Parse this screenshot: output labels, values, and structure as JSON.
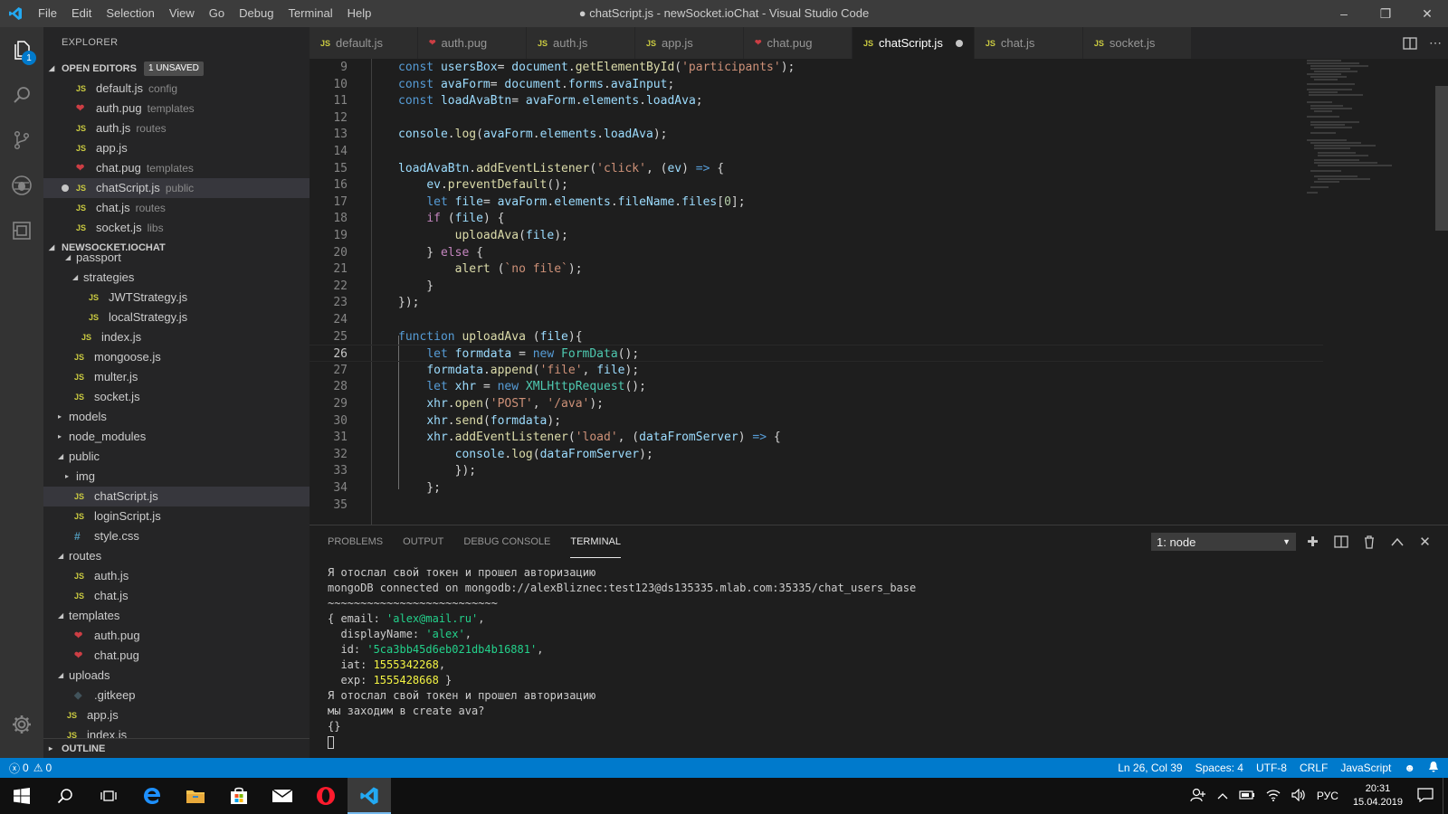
{
  "titlebar": {
    "menus": [
      "File",
      "Edit",
      "Selection",
      "View",
      "Go",
      "Debug",
      "Terminal",
      "Help"
    ],
    "title": "● chatScript.js - newSocket.ioChat - Visual Studio Code",
    "minimize": "–",
    "maximize": "❐",
    "close": "✕"
  },
  "activitybar": {
    "items": [
      "files-icon",
      "search-icon",
      "source-control-icon",
      "debug-icon",
      "extensions-icon"
    ],
    "explorer_badge": "1"
  },
  "sidebar": {
    "title": "EXPLORER",
    "open_editors": {
      "header": "OPEN EDITORS",
      "badge": "1 UNSAVED",
      "items": [
        {
          "icon": "JS",
          "name": "default.js",
          "desc": "config"
        },
        {
          "icon": "pug",
          "name": "auth.pug",
          "desc": "templates"
        },
        {
          "icon": "JS",
          "name": "auth.js",
          "desc": "routes"
        },
        {
          "icon": "JS",
          "name": "app.js",
          "desc": ""
        },
        {
          "icon": "pug",
          "name": "chat.pug",
          "desc": "templates"
        },
        {
          "icon": "JS",
          "name": "chatScript.js",
          "desc": "public"
        },
        {
          "icon": "JS",
          "name": "chat.js",
          "desc": "routes"
        },
        {
          "icon": "JS",
          "name": "socket.js",
          "desc": "libs"
        }
      ]
    },
    "project": {
      "header": "NEWSOCKET.IOCHAT",
      "items": [
        {
          "name": "passport",
          "type": "folder-open",
          "indent": 2
        },
        {
          "name": "strategies",
          "type": "folder-open",
          "indent": 3
        },
        {
          "name": "JWTStrategy.js",
          "type": "js",
          "indent": 4
        },
        {
          "name": "localStrategy.js",
          "type": "js",
          "indent": 4
        },
        {
          "name": "index.js",
          "type": "js",
          "indent": 3
        },
        {
          "name": "mongoose.js",
          "type": "js",
          "indent": 2
        },
        {
          "name": "multer.js",
          "type": "js",
          "indent": 2
        },
        {
          "name": "socket.js",
          "type": "js",
          "indent": 2
        },
        {
          "name": "models",
          "type": "folder",
          "indent": 1
        },
        {
          "name": "node_modules",
          "type": "folder",
          "indent": 1
        },
        {
          "name": "public",
          "type": "folder-open",
          "indent": 1
        },
        {
          "name": "img",
          "type": "folder",
          "indent": 2
        },
        {
          "name": "chatScript.js",
          "type": "js",
          "indent": 2
        },
        {
          "name": "loginScript.js",
          "type": "js",
          "indent": 2
        },
        {
          "name": "style.css",
          "type": "css",
          "indent": 2
        },
        {
          "name": "routes",
          "type": "folder-open",
          "indent": 1
        },
        {
          "name": "auth.js",
          "type": "js",
          "indent": 2
        },
        {
          "name": "chat.js",
          "type": "js",
          "indent": 2
        },
        {
          "name": "templates",
          "type": "folder-open",
          "indent": 1
        },
        {
          "name": "auth.pug",
          "type": "pug",
          "indent": 2
        },
        {
          "name": "chat.pug",
          "type": "pug",
          "indent": 2
        },
        {
          "name": "uploads",
          "type": "folder-open",
          "indent": 1
        },
        {
          "name": ".gitkeep",
          "type": "git",
          "indent": 2
        },
        {
          "name": "app.js",
          "type": "js",
          "indent": 1
        },
        {
          "name": "index.js",
          "type": "js",
          "indent": 1
        }
      ]
    },
    "outline_header": "OUTLINE"
  },
  "tabs": [
    {
      "icon": "JS",
      "label": "default.js"
    },
    {
      "icon": "pug",
      "label": "auth.pug"
    },
    {
      "icon": "JS",
      "label": "auth.js"
    },
    {
      "icon": "JS",
      "label": "app.js"
    },
    {
      "icon": "pug",
      "label": "chat.pug"
    },
    {
      "icon": "JS",
      "label": "chatScript.js"
    },
    {
      "icon": "JS",
      "label": "chat.js"
    },
    {
      "icon": "JS",
      "label": "socket.js"
    }
  ],
  "editor": {
    "lines": [
      {
        "n": "9",
        "tokens": [
          [
            "kw",
            "const "
          ],
          [
            "vr",
            "usersBox"
          ],
          [
            "",
            "= "
          ],
          [
            "vr",
            "document"
          ],
          [
            "",
            "."
          ],
          [
            "fn",
            "getElementById"
          ],
          [
            "",
            "("
          ],
          [
            "st",
            "'participants'"
          ],
          [
            "",
            ");"
          ]
        ]
      },
      {
        "n": "10",
        "tokens": [
          [
            "kw",
            "const "
          ],
          [
            "vr",
            "avaForm"
          ],
          [
            "",
            "= "
          ],
          [
            "vr",
            "document"
          ],
          [
            "",
            "."
          ],
          [
            "vr",
            "forms"
          ],
          [
            "",
            "."
          ],
          [
            "vr",
            "avaInput"
          ],
          [
            "",
            ";"
          ]
        ]
      },
      {
        "n": "11",
        "tokens": [
          [
            "kw",
            "const "
          ],
          [
            "vr",
            "loadAvaBtn"
          ],
          [
            "",
            "= "
          ],
          [
            "vr",
            "avaForm"
          ],
          [
            "",
            "."
          ],
          [
            "vr",
            "elements"
          ],
          [
            "",
            "."
          ],
          [
            "vr",
            "loadAva"
          ],
          [
            "",
            ";"
          ]
        ]
      },
      {
        "n": "12",
        "tokens": []
      },
      {
        "n": "13",
        "tokens": [
          [
            "vr",
            "console"
          ],
          [
            "",
            "."
          ],
          [
            "fn",
            "log"
          ],
          [
            "",
            "("
          ],
          [
            "vr",
            "avaForm"
          ],
          [
            "",
            "."
          ],
          [
            "vr",
            "elements"
          ],
          [
            "",
            "."
          ],
          [
            "vr",
            "loadAva"
          ],
          [
            "",
            ");"
          ]
        ]
      },
      {
        "n": "14",
        "tokens": []
      },
      {
        "n": "15",
        "tokens": [
          [
            "vr",
            "loadAvaBtn"
          ],
          [
            "",
            "."
          ],
          [
            "fn",
            "addEventListener"
          ],
          [
            "",
            "("
          ],
          [
            "st",
            "'click'"
          ],
          [
            "",
            ", ("
          ],
          [
            "vr",
            "ev"
          ],
          [
            "",
            ") "
          ],
          [
            "kw",
            "=>"
          ],
          [
            "",
            " {"
          ]
        ]
      },
      {
        "n": "16",
        "tokens": [
          [
            "",
            "    "
          ],
          [
            "vr",
            "ev"
          ],
          [
            "",
            "."
          ],
          [
            "fn",
            "preventDefault"
          ],
          [
            "",
            "();"
          ]
        ]
      },
      {
        "n": "17",
        "tokens": [
          [
            "",
            "    "
          ],
          [
            "kw",
            "let "
          ],
          [
            "vr",
            "file"
          ],
          [
            "",
            "= "
          ],
          [
            "vr",
            "avaForm"
          ],
          [
            "",
            "."
          ],
          [
            "vr",
            "elements"
          ],
          [
            "",
            "."
          ],
          [
            "vr",
            "fileName"
          ],
          [
            "",
            "."
          ],
          [
            "vr",
            "files"
          ],
          [
            "",
            "["
          ],
          [
            "nm",
            "0"
          ],
          [
            "",
            "];"
          ]
        ]
      },
      {
        "n": "18",
        "tokens": [
          [
            "",
            "    "
          ],
          [
            "ct",
            "if "
          ],
          [
            "",
            "("
          ],
          [
            "vr",
            "file"
          ],
          [
            "",
            ") {"
          ]
        ]
      },
      {
        "n": "19",
        "tokens": [
          [
            "",
            "        "
          ],
          [
            "fn",
            "uploadAva"
          ],
          [
            "",
            "("
          ],
          [
            "vr",
            "file"
          ],
          [
            "",
            ");"
          ]
        ]
      },
      {
        "n": "20",
        "tokens": [
          [
            "",
            "    } "
          ],
          [
            "ct",
            "else "
          ],
          [
            "",
            "{"
          ]
        ]
      },
      {
        "n": "21",
        "tokens": [
          [
            "",
            "        "
          ],
          [
            "fn",
            "alert "
          ],
          [
            "",
            "("
          ],
          [
            "st",
            "`no file`"
          ],
          [
            "",
            ");"
          ]
        ]
      },
      {
        "n": "22",
        "tokens": [
          [
            "",
            "    }"
          ]
        ]
      },
      {
        "n": "23",
        "tokens": [
          [
            "",
            "});"
          ]
        ]
      },
      {
        "n": "24",
        "tokens": []
      },
      {
        "n": "25",
        "tokens": [
          [
            "kw",
            "function "
          ],
          [
            "fn",
            "uploadAva "
          ],
          [
            "",
            "("
          ],
          [
            "vr",
            "file"
          ],
          [
            "",
            "){"
          ]
        ]
      },
      {
        "n": "26",
        "tokens": [
          [
            "",
            "    "
          ],
          [
            "kw",
            "let "
          ],
          [
            "vr",
            "formdata "
          ],
          [
            "",
            "= "
          ],
          [
            "kw",
            "new "
          ],
          [
            "cl",
            "FormData"
          ],
          [
            "",
            "();"
          ]
        ]
      },
      {
        "n": "27",
        "tokens": [
          [
            "",
            "    "
          ],
          [
            "vr",
            "formdata"
          ],
          [
            "",
            "."
          ],
          [
            "fn",
            "append"
          ],
          [
            "",
            "("
          ],
          [
            "st",
            "'file'"
          ],
          [
            "",
            ", "
          ],
          [
            "vr",
            "file"
          ],
          [
            "",
            ");"
          ]
        ]
      },
      {
        "n": "28",
        "tokens": [
          [
            "",
            "    "
          ],
          [
            "kw",
            "let "
          ],
          [
            "vr",
            "xhr "
          ],
          [
            "",
            "= "
          ],
          [
            "kw",
            "new "
          ],
          [
            "cl",
            "XMLHttpRequest"
          ],
          [
            "",
            "();"
          ]
        ]
      },
      {
        "n": "29",
        "tokens": [
          [
            "",
            "    "
          ],
          [
            "vr",
            "xhr"
          ],
          [
            "",
            "."
          ],
          [
            "fn",
            "open"
          ],
          [
            "",
            "("
          ],
          [
            "st",
            "'POST'"
          ],
          [
            "",
            ", "
          ],
          [
            "st",
            "'/ava'"
          ],
          [
            "",
            ");"
          ]
        ]
      },
      {
        "n": "30",
        "tokens": [
          [
            "",
            "    "
          ],
          [
            "vr",
            "xhr"
          ],
          [
            "",
            "."
          ],
          [
            "fn",
            "send"
          ],
          [
            "",
            "("
          ],
          [
            "vr",
            "formdata"
          ],
          [
            "",
            ");"
          ]
        ]
      },
      {
        "n": "31",
        "tokens": [
          [
            "",
            "    "
          ],
          [
            "vr",
            "xhr"
          ],
          [
            "",
            "."
          ],
          [
            "fn",
            "addEventListener"
          ],
          [
            "",
            "("
          ],
          [
            "st",
            "'load'"
          ],
          [
            "",
            ", ("
          ],
          [
            "vr",
            "dataFromServer"
          ],
          [
            "",
            ") "
          ],
          [
            "kw",
            "=>"
          ],
          [
            "",
            " {"
          ]
        ]
      },
      {
        "n": "32",
        "tokens": [
          [
            "",
            "        "
          ],
          [
            "vr",
            "console"
          ],
          [
            "",
            "."
          ],
          [
            "fn",
            "log"
          ],
          [
            "",
            "("
          ],
          [
            "vr",
            "dataFromServer"
          ],
          [
            "",
            ");"
          ]
        ]
      },
      {
        "n": "33",
        "tokens": [
          [
            "",
            "        });"
          ]
        ]
      },
      {
        "n": "34",
        "tokens": [
          [
            "",
            "    };"
          ]
        ]
      },
      {
        "n": "35",
        "tokens": []
      }
    ],
    "current_line": "26"
  },
  "panel": {
    "tabs": [
      "PROBLEMS",
      "OUTPUT",
      "DEBUG CONSOLE",
      "TERMINAL"
    ],
    "active_tab": "TERMINAL",
    "terminal_select": "1: node",
    "terminal_lines": [
      [
        [
          "",
          "Я отослал свой токен и прошел авторизацию"
        ]
      ],
      [
        [
          "",
          "mongoDB connected on mongodb://alexBliznec:test123@ds135335.mlab.com:35335/chat_users_base"
        ]
      ],
      [
        [
          "",
          "~~~~~~~~~~~~~~~~~~~~~~~~~~"
        ]
      ],
      [
        [
          "",
          "{ email: "
        ],
        [
          "tg",
          "'alex@mail.ru'"
        ],
        [
          "",
          ","
        ]
      ],
      [
        [
          "",
          "  displayName: "
        ],
        [
          "tg",
          "'alex'"
        ],
        [
          "",
          ","
        ]
      ],
      [
        [
          "",
          "  id: "
        ],
        [
          "tg",
          "'5ca3bb45d6eb021db4b16881'"
        ],
        [
          "",
          ","
        ]
      ],
      [
        [
          "",
          "  iat: "
        ],
        [
          "ty",
          "1555342268"
        ],
        [
          "",
          ","
        ]
      ],
      [
        [
          "",
          "  exp: "
        ],
        [
          "ty",
          "1555428668"
        ],
        [
          "",
          " }"
        ]
      ],
      [
        [
          "",
          "Я отослал свой токен и прошел авторизацию"
        ]
      ],
      [
        [
          "",
          "мы заходим в create ava?"
        ]
      ],
      [
        [
          "",
          "{}"
        ]
      ]
    ]
  },
  "statusbar": {
    "errors": "0",
    "warnings": "0",
    "position": "Ln 26, Col 39",
    "spaces": "Spaces: 4",
    "encoding": "UTF-8",
    "eol": "CRLF",
    "language": "JavaScript"
  },
  "taskbar": {
    "apps": [
      "start-icon",
      "search-icon",
      "task-view-icon",
      "edge-icon",
      "file-explorer-icon",
      "store-icon",
      "mail-icon",
      "opera-icon",
      "vscode-icon"
    ],
    "lang": "РУС",
    "time": "20:31",
    "date": "15.04.2019"
  },
  "colors": {
    "accent": "#007acc",
    "js_icon": "#cbcb41",
    "pug_icon": "#cc3e44"
  }
}
